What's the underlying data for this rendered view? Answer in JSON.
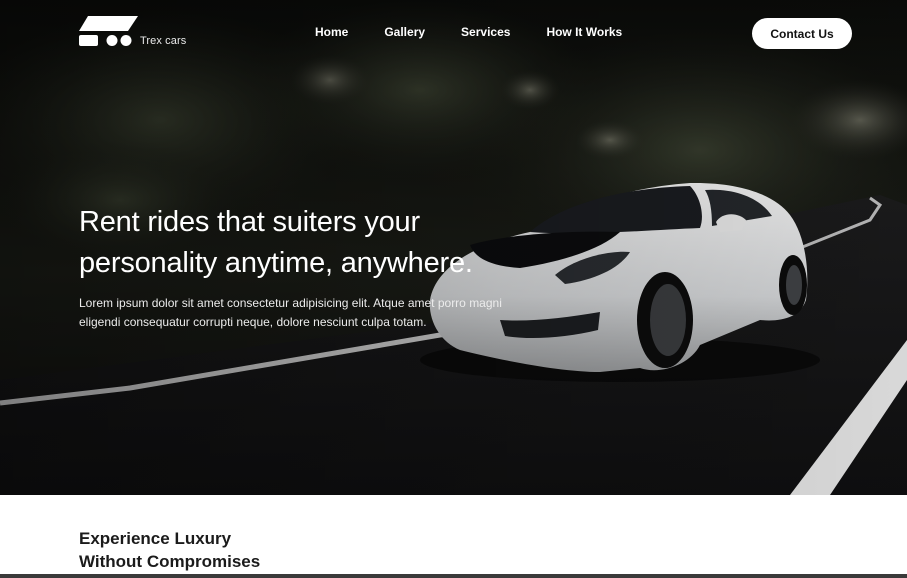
{
  "brand": {
    "name": "Trex cars",
    "logo_icon": "car-logo-icon"
  },
  "nav": {
    "links": [
      "Home",
      "Gallery",
      "Services",
      "How It Works"
    ],
    "cta_label": "Contact Us"
  },
  "hero": {
    "title_line1": "Rent rides that suiters your",
    "title_line2": "personality anytime, anywhere.",
    "description_line1": "Lorem ipsum dolor sit amet consectetur adipisicing elit. Atque amet porro magni",
    "description_line2": "eligendi consequatur corrupti neque, dolore nesciunt culpa totam.",
    "image": "white-sports-car-on-road"
  },
  "section": {
    "title_line1": "Experience Luxury",
    "title_line2": "Without Compromises"
  },
  "colors": {
    "hero_bg": "#0e0f0c",
    "text_light": "#ffffff",
    "button_bg": "#ffffff",
    "button_text": "#111111",
    "section_text": "#1b1b1b"
  }
}
